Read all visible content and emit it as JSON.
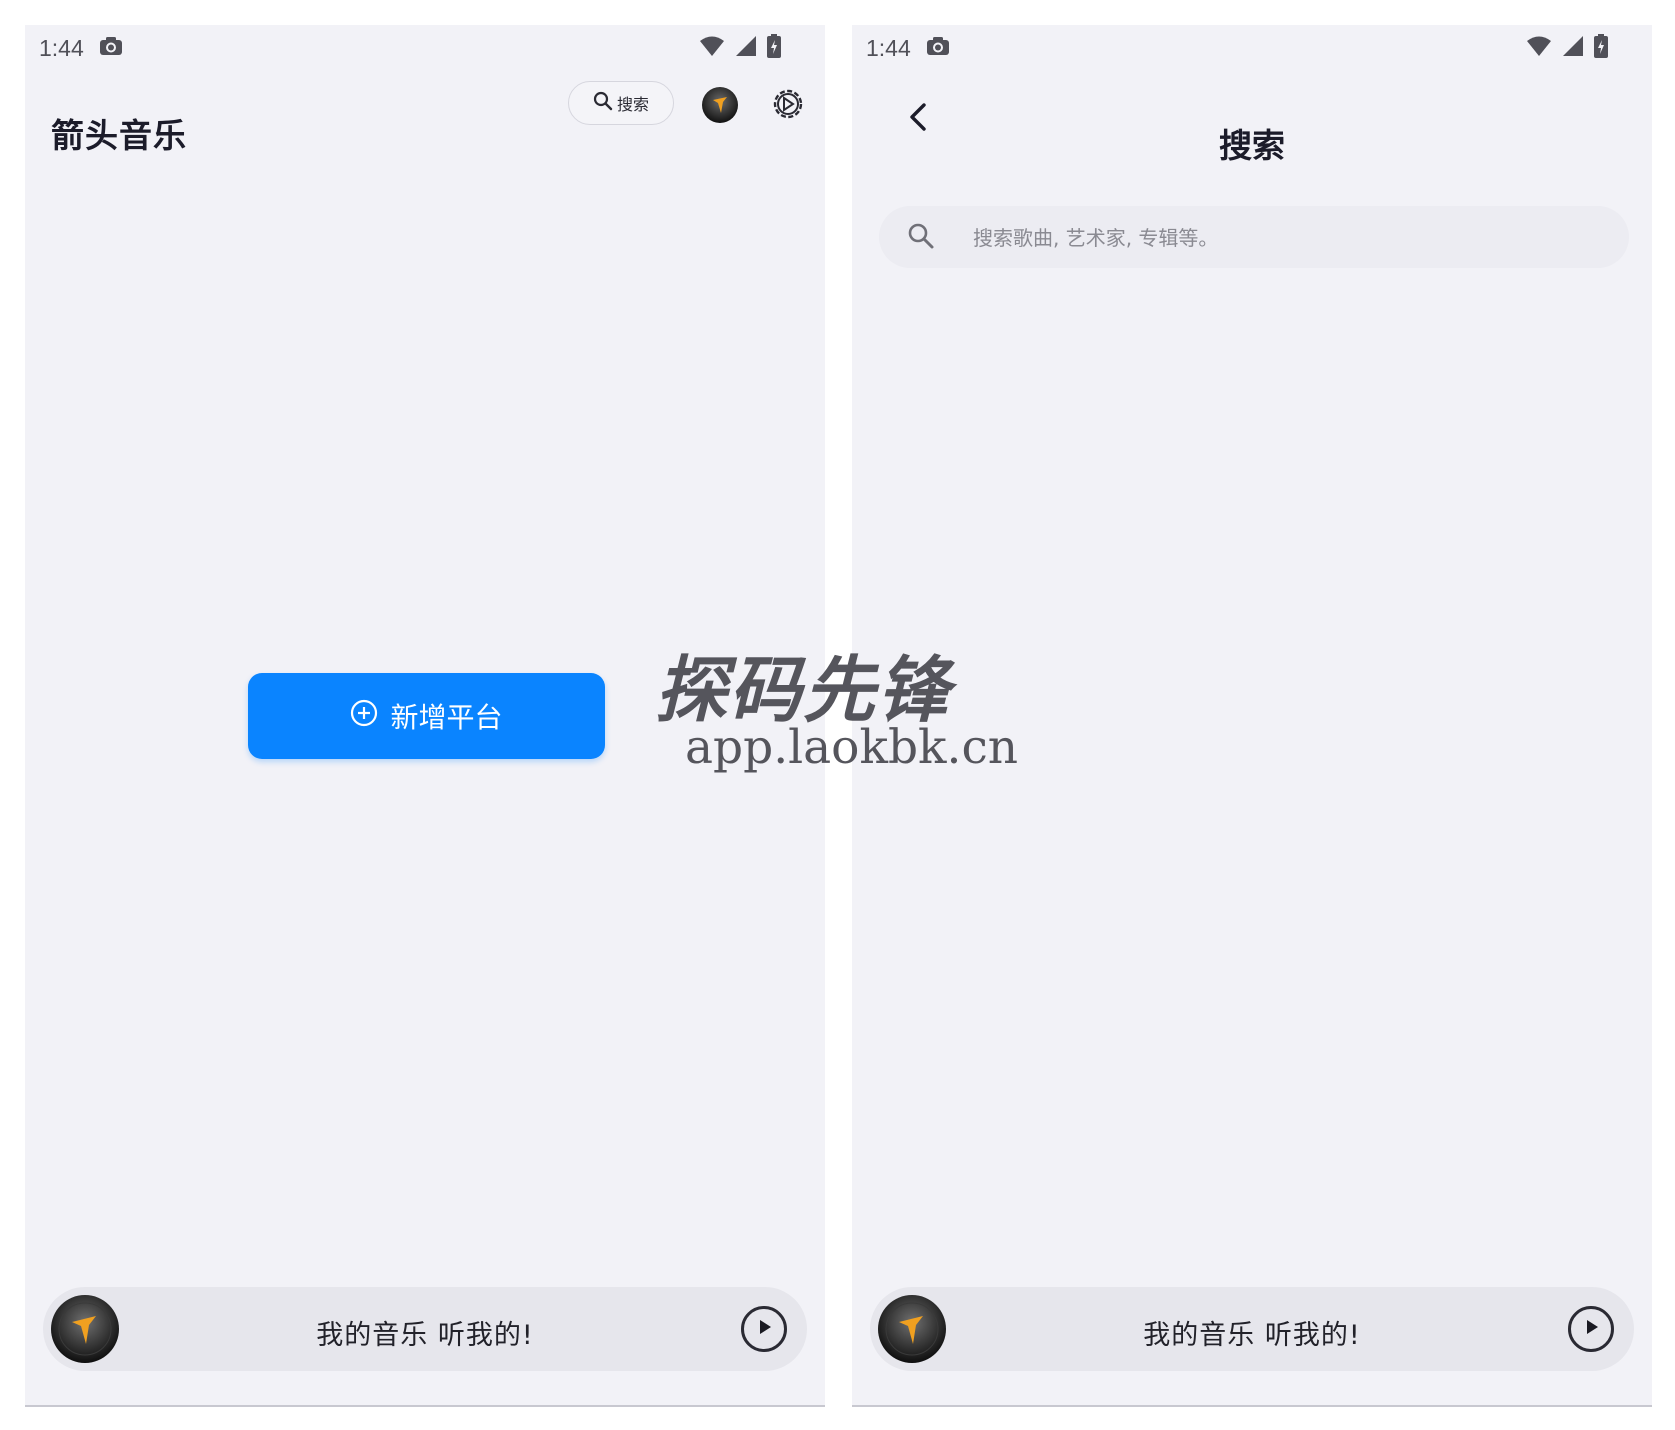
{
  "left_screen": {
    "status_time": "1:44",
    "app_title": "箭头音乐",
    "search_label": "搜索",
    "add_platform_label": "新增平台",
    "player_text": "我的音乐 听我的!"
  },
  "right_screen": {
    "status_time": "1:44",
    "page_title": "搜索",
    "search_placeholder": "搜索歌曲, 艺术家, 专辑等。",
    "player_text": "我的音乐 听我的!"
  },
  "watermark": {
    "title": "探码先锋",
    "url": "app.laokbk.cn"
  },
  "icons": {
    "camera": "camera-icon",
    "wifi": "wifi-icon",
    "signal": "signal-icon",
    "battery": "battery-icon",
    "search": "search-icon",
    "disc": "vinyl-disc-icon",
    "settings": "settings-gear-icon",
    "add": "plus-circle-icon",
    "play": "play-icon",
    "back": "chevron-left-icon"
  },
  "colors": {
    "background": "#f2f2f7",
    "accent": "#0a84ff",
    "disc_orange": "#f0a020"
  }
}
